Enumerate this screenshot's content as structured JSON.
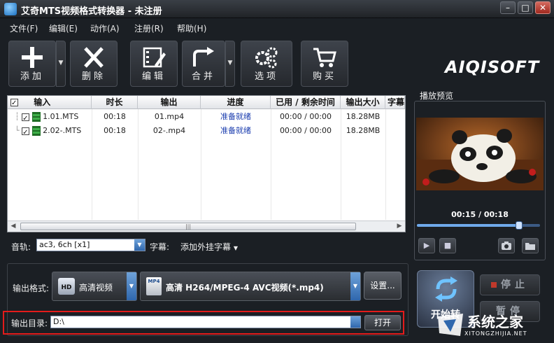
{
  "window": {
    "title": "艾奇MTS视频格式转换器 - 未注册",
    "minimize_glyph": "–",
    "maximize_glyph": "□",
    "close_glyph": "✕"
  },
  "menu": [
    {
      "label": "文件(F)"
    },
    {
      "label": "编辑(E)"
    },
    {
      "label": "动作(A)"
    },
    {
      "label": "注册(R)"
    },
    {
      "label": "帮助(H)"
    }
  ],
  "toolbar": {
    "add": "添加",
    "delete": "删除",
    "edit": "编辑",
    "merge": "合并",
    "options": "选项",
    "buy": "购买",
    "brand": "AIQISOFT"
  },
  "file_table": {
    "columns": [
      "输入",
      "时长",
      "输出",
      "进度",
      "已用 / 剩余时间",
      "输出大小",
      "字幕"
    ],
    "rows": [
      {
        "input": "1.01.MTS",
        "duration": "00:18",
        "output": "01.mp4",
        "status": "准备就绪",
        "time": "00:00 / 00:00",
        "size": "18.28MB"
      },
      {
        "input": "2.02-.MTS",
        "duration": "00:18",
        "output": "02-.mp4",
        "status": "准备就绪",
        "time": "00:00 / 00:00",
        "size": "18.28MB"
      }
    ],
    "scroll_grip": "|||"
  },
  "audio": {
    "label": "音轨:",
    "value": "ac3, 6ch [x1]",
    "subtitle_label": "字幕:",
    "subtitle_value": "添加外挂字幕"
  },
  "preview": {
    "title": "播放预览",
    "time": "00:15 / 00:18",
    "progress": 0.83
  },
  "output": {
    "format_label": "输出格式:",
    "category": "高清视频",
    "profile": "高清 H264/MPEG-4 AVC视频(*.mp4)",
    "settings": "设置...",
    "dir_label": "输出目录:",
    "dir_value": "D:\\",
    "open": "打开",
    "hd_badge": "HD",
    "mp4_badge": "MP4"
  },
  "actions": {
    "start": "开始转",
    "stop": "停止",
    "pause": "暂停"
  },
  "watermark": {
    "text": "系统之家",
    "url": "XITONGZHIJIA.NET"
  },
  "colors": {
    "background": "#1b1f24",
    "status_text": "#1a3cae",
    "highlight_border": "#e41b1b",
    "accent_blue": "#2f67ad"
  }
}
